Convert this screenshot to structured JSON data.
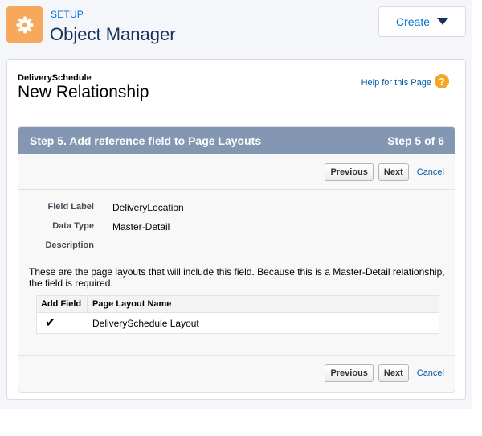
{
  "header": {
    "section_label": "SETUP",
    "title": "Object Manager",
    "create_button": "Create"
  },
  "page": {
    "object_name": "DeliverySchedule",
    "title": "New Relationship",
    "help_link": "Help for this Page",
    "help_icon": "?"
  },
  "step": {
    "title": "Step 5. Add reference field to Page Layouts",
    "counter": "Step 5 of 6",
    "previous_label": "Previous",
    "next_label": "Next",
    "cancel_label": "Cancel"
  },
  "fields": [
    {
      "label": "Field Label",
      "value": "DeliveryLocation"
    },
    {
      "label": "Data Type",
      "value": "Master-Detail"
    },
    {
      "label": "Description",
      "value": ""
    }
  ],
  "info_text": "These are the page layouts that will include this field. Because this is a Master-Detail relationship, the field is required.",
  "layout_table": {
    "headers": [
      "Add Field",
      "Page Layout Name"
    ],
    "rows": [
      {
        "checked": "✔",
        "name": "DeliverySchedule Layout"
      }
    ]
  },
  "colors": {
    "accent": "#0070d2",
    "header_icon_bg": "#f6a95d",
    "step_header_bg": "#8397b3",
    "help_icon_bg": "#f6a623"
  },
  "icons": {
    "setup": "gear-icon",
    "create_caret": "caret-down-icon",
    "help": "help-icon",
    "check": "checkmark-icon"
  }
}
